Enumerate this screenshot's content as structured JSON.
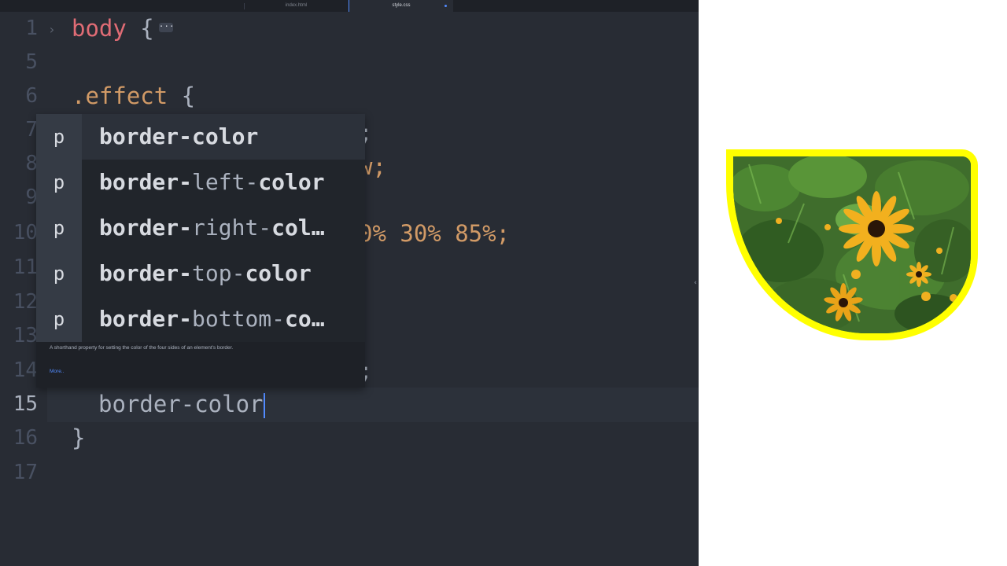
{
  "tabs": [
    {
      "label": "index.html",
      "active": false
    },
    {
      "label": "style.css",
      "active": true
    }
  ],
  "gutter": [
    {
      "number": "1"
    },
    {
      "number": "5"
    },
    {
      "number": "6"
    },
    {
      "number": "7"
    },
    {
      "number": "8"
    },
    {
      "number": "9"
    },
    {
      "number": "10"
    },
    {
      "number": "11"
    },
    {
      "number": "12"
    },
    {
      "number": "13"
    },
    {
      "number": "14"
    },
    {
      "number": "15"
    },
    {
      "number": "16"
    },
    {
      "number": "17"
    }
  ],
  "code": {
    "line1_selector": "body",
    "line1_brace": " {",
    "line1_fold": "···",
    "line6_selector": ".effect",
    "line6_brace": " {",
    "line7_tail": ";",
    "line8_tail": "w;",
    "line10_tail": "0% 30% 85%;",
    "line14_tail": ";",
    "line15_property": "border-color",
    "line16_brace": "}"
  },
  "autocomplete": {
    "items": [
      {
        "type": "p",
        "bold1": "border-",
        "dim": "",
        "bold2": "color"
      },
      {
        "type": "p",
        "bold1": "border-",
        "dim": "left-",
        "bold2": "color"
      },
      {
        "type": "p",
        "bold1": "border-",
        "dim": "right-",
        "bold2": "col…"
      },
      {
        "type": "p",
        "bold1": "border-",
        "dim": "top-",
        "bold2": "color"
      },
      {
        "type": "p",
        "bold1": "border-",
        "dim": "bottom-",
        "bold2": "co…"
      }
    ],
    "description": "A shorthand property for setting the color of the four sides of an element's border.",
    "more_link": "More.."
  },
  "preview": {
    "border_color": "#ffff00",
    "image_subject": "black-eyed susan flowers"
  },
  "colors": {
    "editor_bg": "#282c34",
    "accent": "#528bff",
    "selector_red": "#e06c75",
    "value_orange": "#d19a66"
  }
}
